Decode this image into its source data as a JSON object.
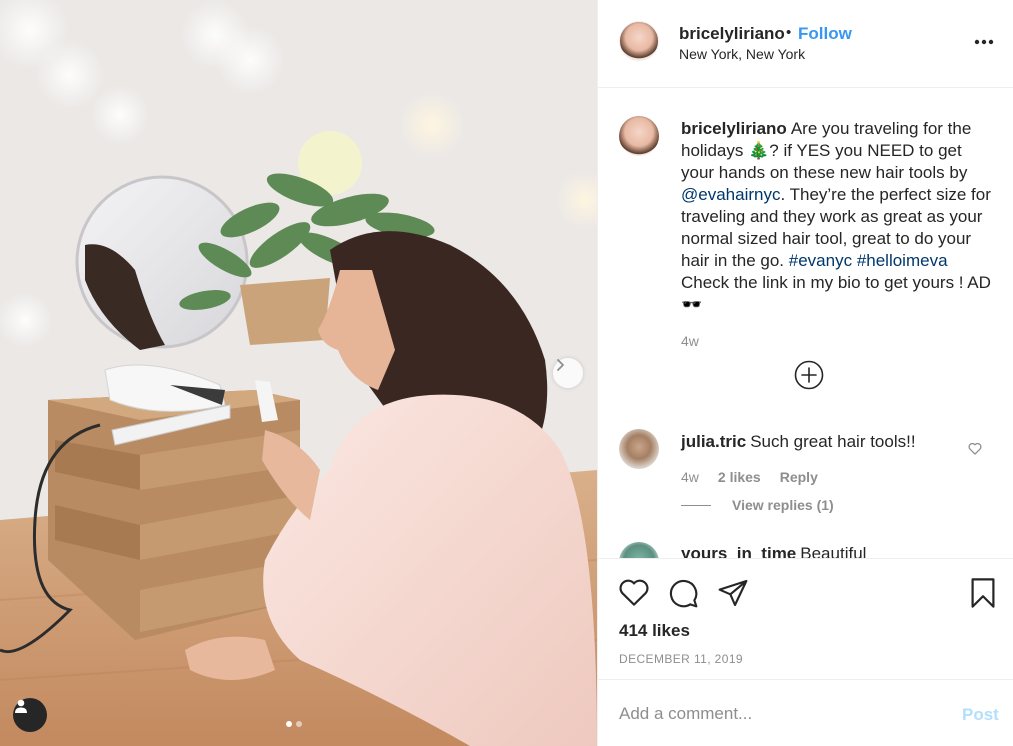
{
  "post": {
    "author": "bricelyliriano",
    "separator": "•",
    "follow_label": "Follow",
    "location": "New York, New York",
    "more_icon": "more-options-icon"
  },
  "caption": {
    "username": "bricelyliriano",
    "text_1": "Are you traveling for the holidays 🎄? if YES you NEED to get your hands on these new hair tools by ",
    "mention": "@evahairnyc",
    "text_2": ". They’re the perfect size for traveling and they work as great as your normal sized hair tool, great to do your hair in the go. ",
    "hashtag_1": "#evanyc",
    "hashtag_2": "#helloimeva",
    "text_3": " Check the link in my bio to get yours ! AD 🕶️",
    "time": "4w"
  },
  "comments": [
    {
      "username": "julia.tric",
      "text": "Such great hair tools!!",
      "time": "4w",
      "likes": "2 likes",
      "reply_label": "Reply",
      "view_replies": "View replies (1)"
    },
    {
      "username": "yours_in_time",
      "text": "Beautiful"
    }
  ],
  "actions": {
    "like_icon": "heart-icon",
    "comment_icon": "comment-icon",
    "share_icon": "share-icon",
    "save_icon": "bookmark-icon",
    "likes": "414 likes",
    "date": "DECEMBER 11, 2019"
  },
  "composer": {
    "placeholder": "Add a comment...",
    "post_label": "Post"
  },
  "colors": {
    "accent": "#3897f0",
    "link": "#00376b",
    "muted": "#8e8e8e",
    "post_disabled": "#b2dffc"
  },
  "carousel": {
    "slide_count": 2,
    "active_slide": 1
  }
}
